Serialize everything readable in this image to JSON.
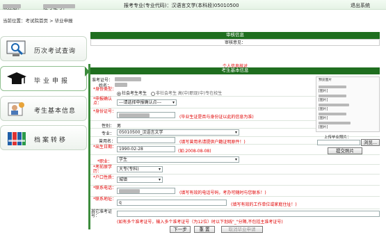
{
  "topbar": {
    "welcome": "欢迎您：",
    "ticket": "准考证号：",
    "major": "报考专业(专业代码)：汉语言文学(本科段)05010500",
    "logout": "退出系统"
  },
  "breadcrumb": "当前位置：考试院首页 > 毕业申报",
  "sidebar": {
    "items": [
      {
        "label": "历次考试查询"
      },
      {
        "label": "毕业申报"
      },
      {
        "label": "考生基本信息"
      },
      {
        "label": "档案转移"
      }
    ]
  },
  "audit": {
    "header": "审核信息",
    "label": "审核意见："
  },
  "personal": {
    "prompt": "个人信息核对",
    "header": "考生基本信息"
  },
  "form": {
    "ticket_label": "准考证号：",
    "name_label": "姓名：",
    "identity_label": "*身份类型：",
    "identity_opt1": "社会考生考生",
    "identity_opt2": "非社会考生 高(中)职现(中)专在校生",
    "point_label": "*申报确认点：",
    "point_value": "---请选择申报确认点---",
    "id_label": "*身份证号：",
    "id_hint": "(毕业生证是否与身份证以此的信息为准)",
    "gender_label": "性别：",
    "gender_value": "男",
    "major_label": "专业：",
    "major_value": "05010500_汉语言文学",
    "used_name_label": "曾用名：",
    "used_name_hint": "(填写曾用名请提供户籍证明原件！)",
    "birth_label": "*出生日期：",
    "birth_value": "1990-02-28",
    "birth_hint": "(如:2008-08-08)",
    "job_label": "*职业：",
    "job_value": "学生",
    "edu_label": "*考前原学历：",
    "edu_value": "大专(专科)",
    "hukou_label": "*户口性质：",
    "hukou_value": "城镇",
    "phone_label": "*联系电话：",
    "phone_hint": "(填写有效的电话号码，考办可随时与您联系！)",
    "addr_label": "*联系地址：",
    "addr_value": "q",
    "addr_hint": "(填写有效的工作单位或家庭住址！)",
    "other_label": "其它准考证号：",
    "other_hint": "(如有多个准考证号，输入多个准考证号（为12位）时以下划线\"_\"分隔,不包括主准考证号)"
  },
  "photo": {
    "title": "预览图片",
    "lines": [
      "[图片]",
      "[图片]",
      "[图片]",
      "[图片]",
      "[图片]"
    ],
    "upload_label": "上传毕业照片：",
    "browse": "浏览...",
    "submit_photo": "提交照片"
  },
  "buttons": {
    "next": "下一步",
    "reset": "重 置",
    "cancel": "取消毕业申请"
  }
}
